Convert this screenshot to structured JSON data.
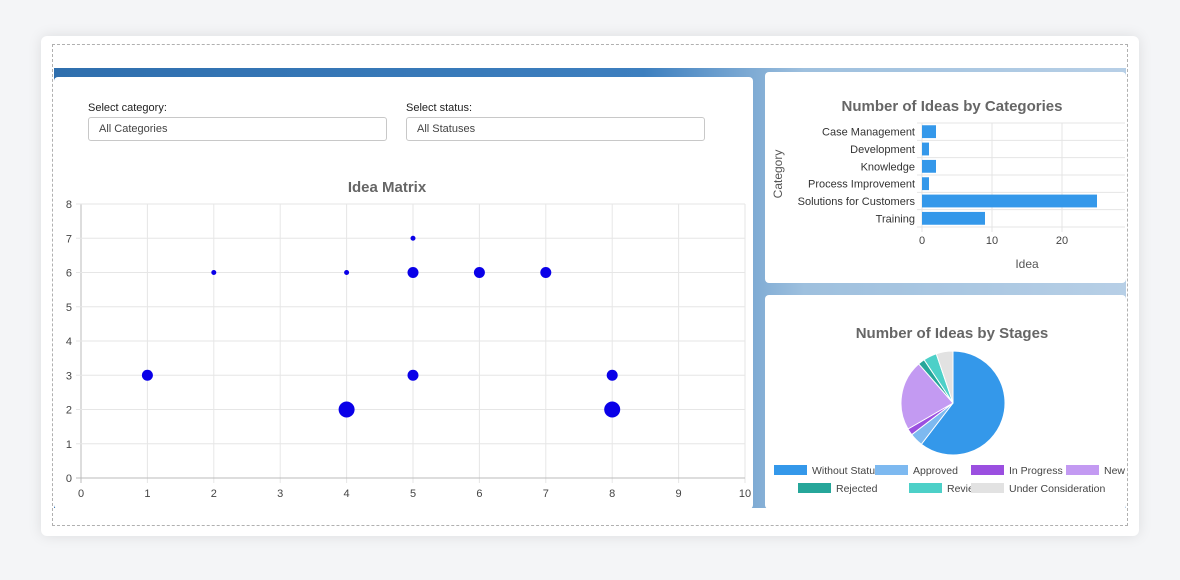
{
  "filters": {
    "category_label": "Select category:",
    "category_value": "All Categories",
    "status_label": "Select status:",
    "status_value": "All Statuses"
  },
  "chart_data": [
    {
      "type": "scatter",
      "title": "Idea Matrix",
      "xlim": [
        0,
        10
      ],
      "ylim": [
        0,
        8
      ],
      "xticks": [
        "0",
        "1",
        "2",
        "3",
        "4",
        "5",
        "6",
        "7",
        "8",
        "9",
        "10"
      ],
      "yticks": [
        "0",
        "1",
        "2",
        "3",
        "4",
        "5",
        "6",
        "7",
        "8"
      ],
      "grid": true,
      "color": "#0a00e8",
      "points": [
        {
          "x": 1,
          "y": 3,
          "size": 2
        },
        {
          "x": 2,
          "y": 6,
          "size": 1
        },
        {
          "x": 4,
          "y": 6,
          "size": 1
        },
        {
          "x": 4,
          "y": 2,
          "size": 3
        },
        {
          "x": 5,
          "y": 7,
          "size": 1
        },
        {
          "x": 5,
          "y": 6,
          "size": 2
        },
        {
          "x": 5,
          "y": 3,
          "size": 2
        },
        {
          "x": 6,
          "y": 6,
          "size": 2
        },
        {
          "x": 7,
          "y": 6,
          "size": 2
        },
        {
          "x": 8,
          "y": 3,
          "size": 2
        },
        {
          "x": 8,
          "y": 2,
          "size": 3
        }
      ]
    },
    {
      "type": "bar",
      "orientation": "horizontal",
      "title": "Number of Ideas by Categories",
      "xlabel": "Idea",
      "ylabel": "Category",
      "categories": [
        "Case Management",
        "Development",
        "Knowledge",
        "Process Improvement",
        "Solutions for Customers",
        "Training"
      ],
      "values": [
        2,
        1,
        2,
        1,
        25,
        9
      ],
      "xticks": [
        "0",
        "10",
        "20"
      ],
      "xlim": [
        0,
        29
      ],
      "color": "#3498ea",
      "grid": true
    },
    {
      "type": "pie",
      "title": "Number of Ideas by Stages",
      "legend_position": "bottom",
      "slices": [
        {
          "label": "Without Status",
          "value": 58,
          "color": "#3498ea"
        },
        {
          "label": "Approved",
          "value": 4,
          "color": "#7db9f0"
        },
        {
          "label": "In Progress",
          "value": 2,
          "color": "#9b4fe0"
        },
        {
          "label": "New",
          "value": 21,
          "color": "#c39af2"
        },
        {
          "label": "Rejected",
          "value": 2,
          "color": "#26a69a"
        },
        {
          "label": "Reviewed",
          "value": 4,
          "color": "#4dd0c8"
        },
        {
          "label": "Under Consideration",
          "value": 5,
          "color": "#e2e2e2"
        }
      ]
    }
  ]
}
